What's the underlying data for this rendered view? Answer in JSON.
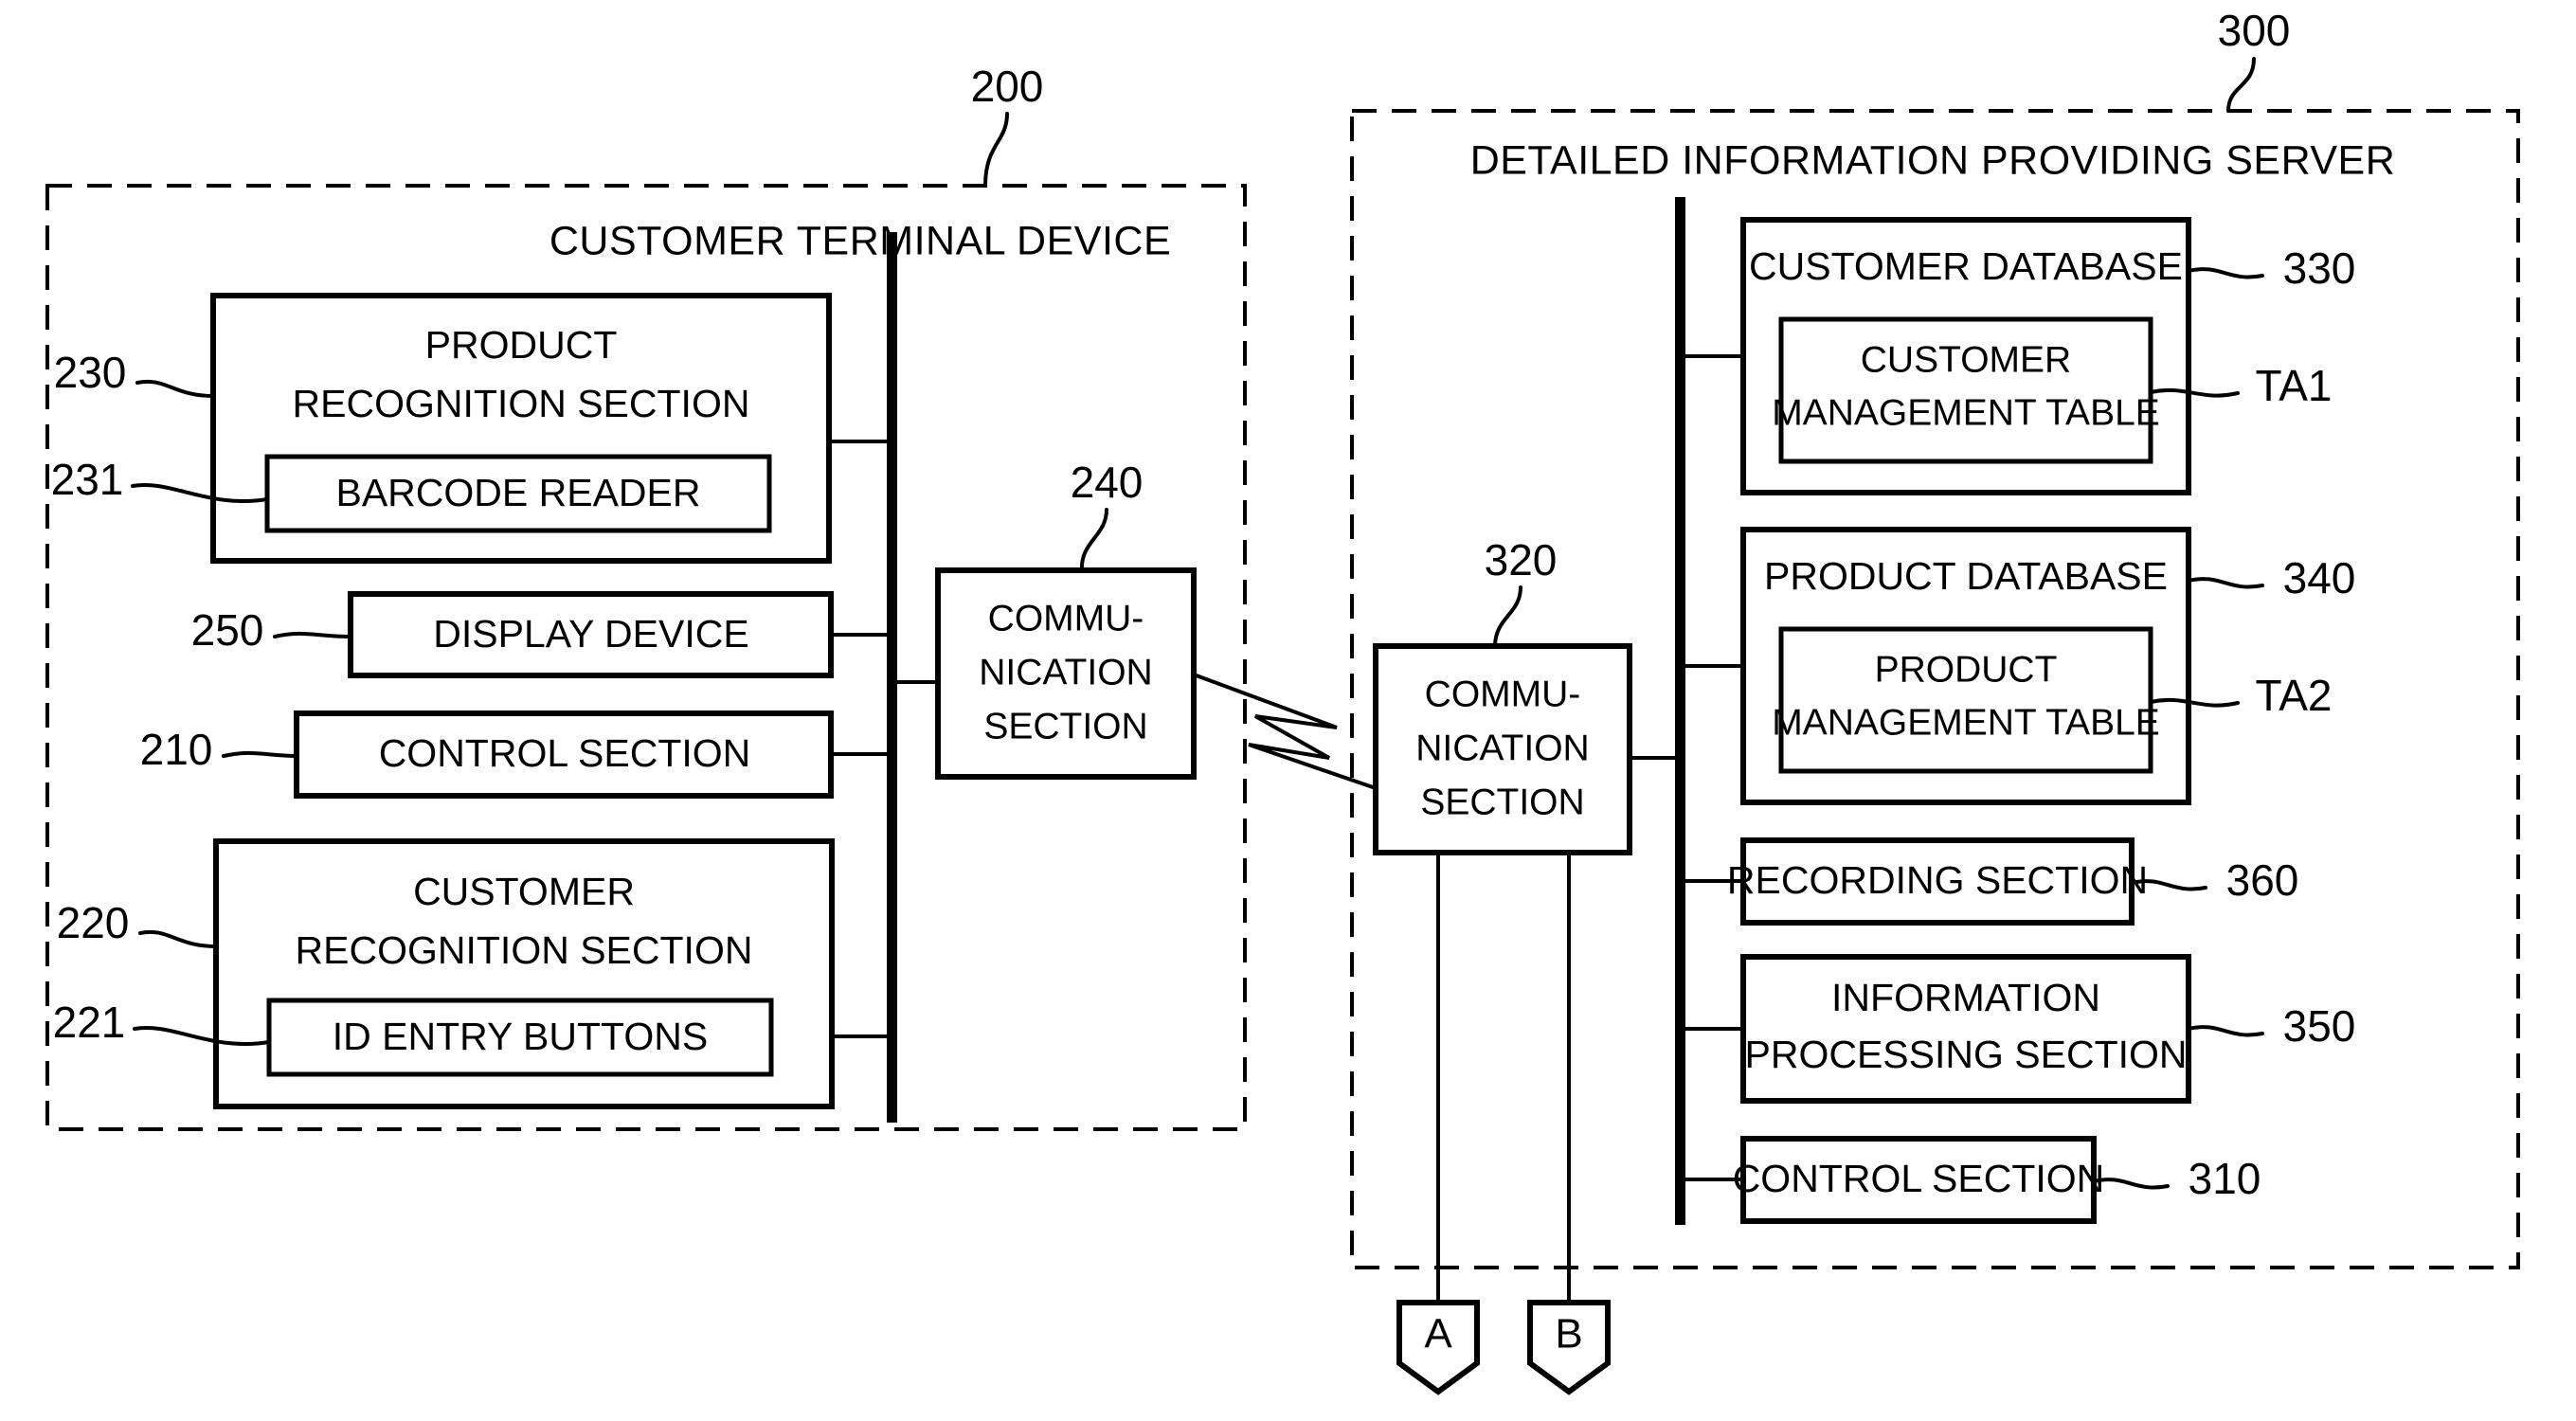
{
  "figure": {
    "type": "patent-block-diagram",
    "background_color": "#ffffff",
    "line_color": "#000000"
  },
  "terminal": {
    "title": "CUSTOMER TERMINAL DEVICE",
    "ref": "200",
    "product_recognition": {
      "label": "PRODUCT\nRECOGNITION SECTION",
      "line1": "PRODUCT",
      "line2": "RECOGNITION SECTION",
      "ref": "230"
    },
    "barcode_reader": {
      "label": "BARCODE READER",
      "ref": "231"
    },
    "display_device": {
      "label": "DISPLAY DEVICE",
      "ref": "250"
    },
    "control_section": {
      "label": "CONTROL SECTION",
      "ref": "210"
    },
    "customer_recognition": {
      "line1": "CUSTOMER",
      "line2": "RECOGNITION SECTION",
      "ref": "220"
    },
    "id_entry_buttons": {
      "label": "ID ENTRY BUTTONS",
      "ref": "221"
    },
    "communication_section": {
      "line1": "COMMU-",
      "line2": "NICATION",
      "line3": "SECTION",
      "ref": "240"
    }
  },
  "server": {
    "title": "DETAILED INFORMATION PROVIDING SERVER",
    "ref": "300",
    "communication_section": {
      "line1": "COMMU-",
      "line2": "NICATION",
      "line3": "SECTION",
      "ref": "320"
    },
    "customer_database": {
      "label": "CUSTOMER DATABASE",
      "ref": "330"
    },
    "customer_management_table": {
      "line1": "CUSTOMER",
      "line2": "MANAGEMENT TABLE",
      "ref": "TA1"
    },
    "product_database": {
      "label": "PRODUCT DATABASE",
      "ref": "340"
    },
    "product_management_table": {
      "line1": "PRODUCT",
      "line2": "MANAGEMENT TABLE",
      "ref": "TA2"
    },
    "recording_section": {
      "label": "RECORDING SECTION",
      "ref": "360"
    },
    "information_processing": {
      "line1": "INFORMATION",
      "line2": "PROCESSING SECTION",
      "ref": "350"
    },
    "control_section": {
      "label": "CONTROL SECTION",
      "ref": "310"
    }
  },
  "connectors": {
    "tag_a": "A",
    "tag_b": "B",
    "wireless_link_icon": "lightning-bolt"
  }
}
